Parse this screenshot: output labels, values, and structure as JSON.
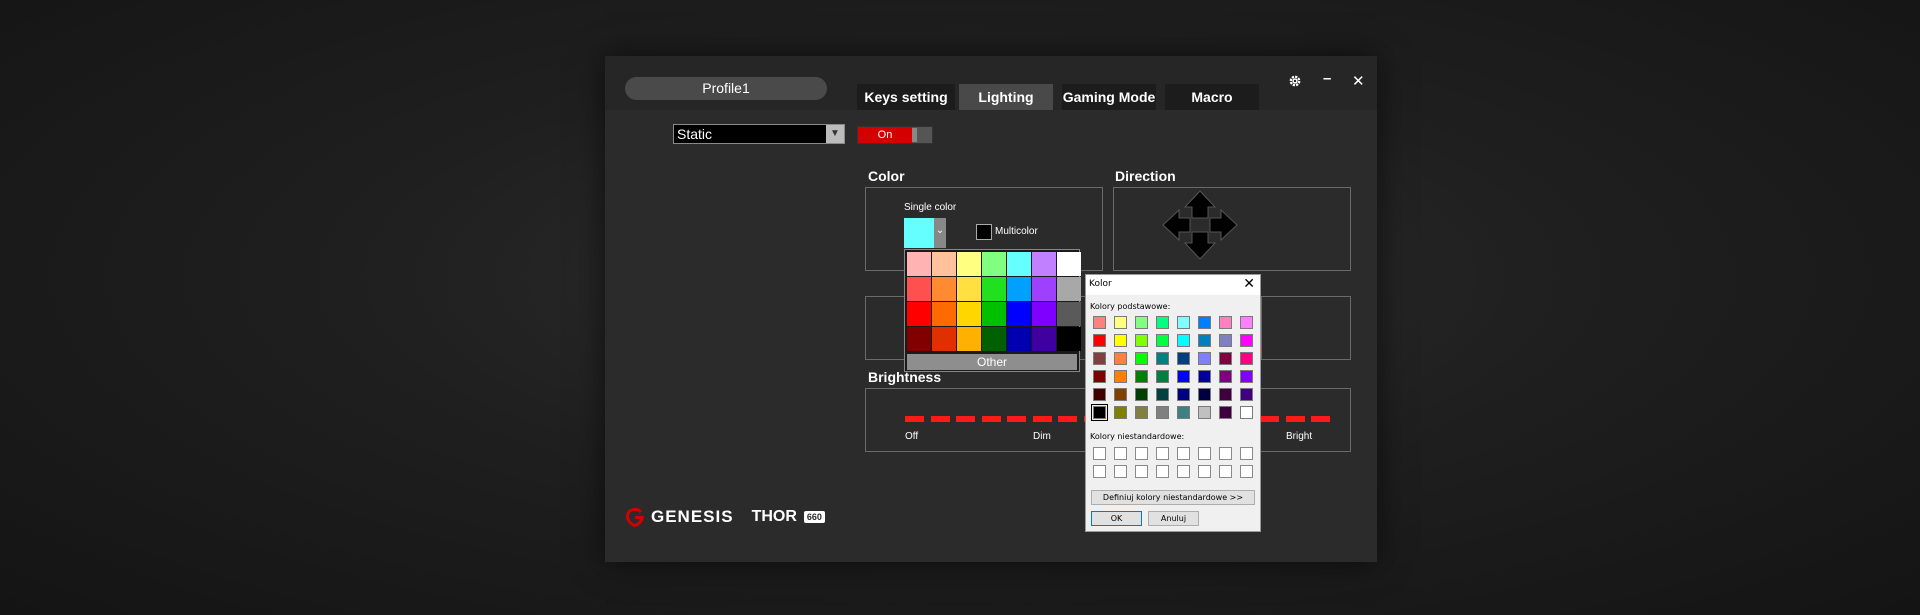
{
  "profile": {
    "name": "Profile1"
  },
  "tabs": [
    {
      "label": "Keys setting",
      "active": false
    },
    {
      "label": "Lighting",
      "active": true
    },
    {
      "label": "Gaming Mode",
      "active": false
    },
    {
      "label": "Macro",
      "active": false
    }
  ],
  "window_controls": {
    "settings_icon": "gear-icon",
    "minimize": "–",
    "close": "✕"
  },
  "lighting": {
    "mode": "Static",
    "toggle_label": "On",
    "accent": "#d40000"
  },
  "color_section": {
    "title": "Color",
    "single_color_label": "Single color",
    "multicolor_label": "Multicolor",
    "selected_color": "#66ffff",
    "palette": [
      [
        "#ffb3b3",
        "#ffc29a",
        "#ffff80",
        "#80ff80",
        "#66ffff",
        "#c080ff",
        "#ffffff"
      ],
      [
        "#ff5050",
        "#ff8a30",
        "#ffe040",
        "#20e020",
        "#00a0ff",
        "#a040ff",
        "#a8a8a8"
      ],
      [
        "#ff0000",
        "#ff6a00",
        "#ffd700",
        "#00c000",
        "#0000ff",
        "#8000ff",
        "#5a5a5a"
      ],
      [
        "#800000",
        "#e03000",
        "#ffb000",
        "#006000",
        "#0000b0",
        "#4000a0",
        "#000000"
      ]
    ],
    "other_label": "Other"
  },
  "direction_section": {
    "title": "Direction"
  },
  "brightness_section": {
    "title": "Brightness",
    "labels": {
      "off": "Off",
      "dim": "Dim",
      "bright": "Bright"
    },
    "level_color": "#ff1a1a"
  },
  "branding": {
    "brand": "GENESIS",
    "model": "THOR",
    "model_badge": "660"
  },
  "color_dialog": {
    "title": "Kolor",
    "basic_label": "Kolory podstawowe:",
    "custom_label": "Kolory niestandardowe:",
    "define_button": "Definiuj kolory niestandardowe >>",
    "ok_button": "OK",
    "cancel_button": "Anuluj",
    "basic_colors": [
      [
        "#ff8080",
        "#ffff80",
        "#80ff80",
        "#00ff80",
        "#80ffff",
        "#0080ff",
        "#ff80c0",
        "#ff80ff"
      ],
      [
        "#ff0000",
        "#ffff00",
        "#80ff00",
        "#00ff40",
        "#00ffff",
        "#0080c0",
        "#8080c0",
        "#ff00ff"
      ],
      [
        "#804040",
        "#ff8040",
        "#00ff00",
        "#008080",
        "#004080",
        "#8080ff",
        "#800040",
        "#ff0080"
      ],
      [
        "#800000",
        "#ff8000",
        "#008000",
        "#008040",
        "#0000ff",
        "#0000a0",
        "#800080",
        "#8000ff"
      ],
      [
        "#400000",
        "#804000",
        "#004000",
        "#004040",
        "#000080",
        "#000040",
        "#400040",
        "#400080"
      ],
      [
        "#000000",
        "#808000",
        "#808040",
        "#808080",
        "#408080",
        "#c0c0c0",
        "#400040",
        "#ffffff"
      ]
    ],
    "selected_index": [
      5,
      0
    ]
  }
}
